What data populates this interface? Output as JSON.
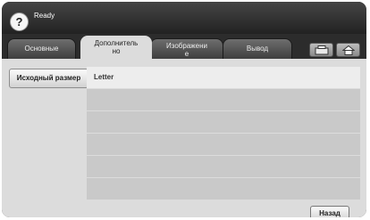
{
  "status": {
    "text": "Ready",
    "help_icon": "?"
  },
  "tabs": [
    {
      "label": "Основные"
    },
    {
      "label": "Дополнитель\nно"
    },
    {
      "label": "Изображени\nе"
    },
    {
      "label": "Вывод"
    }
  ],
  "tab_icons": [
    "copy-icon",
    "home-icon"
  ],
  "option": {
    "label": "Исходный размер",
    "value": "Letter"
  },
  "footer": {
    "back_label": "Назад"
  }
}
